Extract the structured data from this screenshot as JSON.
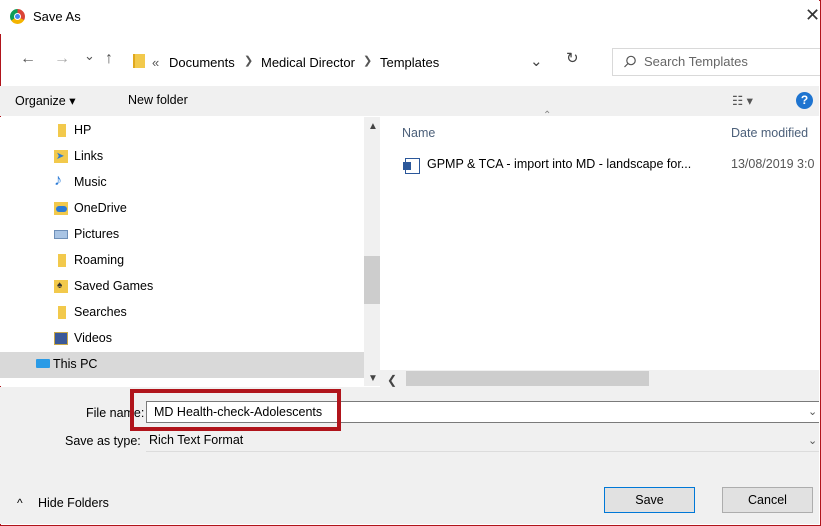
{
  "window": {
    "title": "Save As",
    "close_glyph": "✕"
  },
  "address": {
    "back_glyph": "←",
    "forward_glyph": "→",
    "recent_glyph": "⌄",
    "up_glyph": "↑",
    "overflow": "«",
    "crumbs": [
      "Documents",
      "Medical Director",
      "Templates"
    ],
    "dropdown_glyph": "⌄",
    "refresh_glyph": "↻",
    "search_placeholder": "Search Templates"
  },
  "toolbar": {
    "organize": "Organize ▾",
    "new_folder": "New folder",
    "view_glyph": "☷ ▾",
    "help_glyph": "?"
  },
  "navpane": {
    "items": [
      {
        "label": "HP",
        "icon": "folder-icon",
        "color": "#f2c94c"
      },
      {
        "label": "Links",
        "icon": "links-folder-icon",
        "color": "#3a8ee6"
      },
      {
        "label": "Music",
        "icon": "music-icon",
        "color": "#2b7bd6"
      },
      {
        "label": "OneDrive",
        "icon": "onedrive-folder-icon",
        "color": "#2b7bd6"
      },
      {
        "label": "Pictures",
        "icon": "pictures-icon",
        "color": "#7aa7d8"
      },
      {
        "label": "Roaming",
        "icon": "folder-icon",
        "color": "#f2c94c"
      },
      {
        "label": "Saved Games",
        "icon": "saved-games-icon",
        "color": "#f2c94c"
      },
      {
        "label": "Searches",
        "icon": "searches-icon",
        "color": "#f2c94c"
      },
      {
        "label": "Videos",
        "icon": "videos-icon",
        "color": "#3b5998"
      },
      {
        "label": "This PC",
        "icon": "this-pc-icon",
        "color": "#2b9be6"
      }
    ],
    "selected": "This PC"
  },
  "filelist": {
    "columns": [
      "Name",
      "Date modified"
    ],
    "rows": [
      {
        "name": "GPMP & TCA - import into MD - landscape for...",
        "date": "13/08/2019 3:0"
      }
    ]
  },
  "form": {
    "file_name_label": "File name:",
    "file_name_value": "MD Health-check-Adolescents",
    "save_type_label": "Save as type:",
    "save_type_value": "Rich Text Format"
  },
  "footer": {
    "hide_folders": "Hide Folders",
    "hide_glyph": "^",
    "save": "Save",
    "cancel": "Cancel"
  },
  "colors": {
    "accent": "#0078d7",
    "highlight": "#b0141b"
  }
}
